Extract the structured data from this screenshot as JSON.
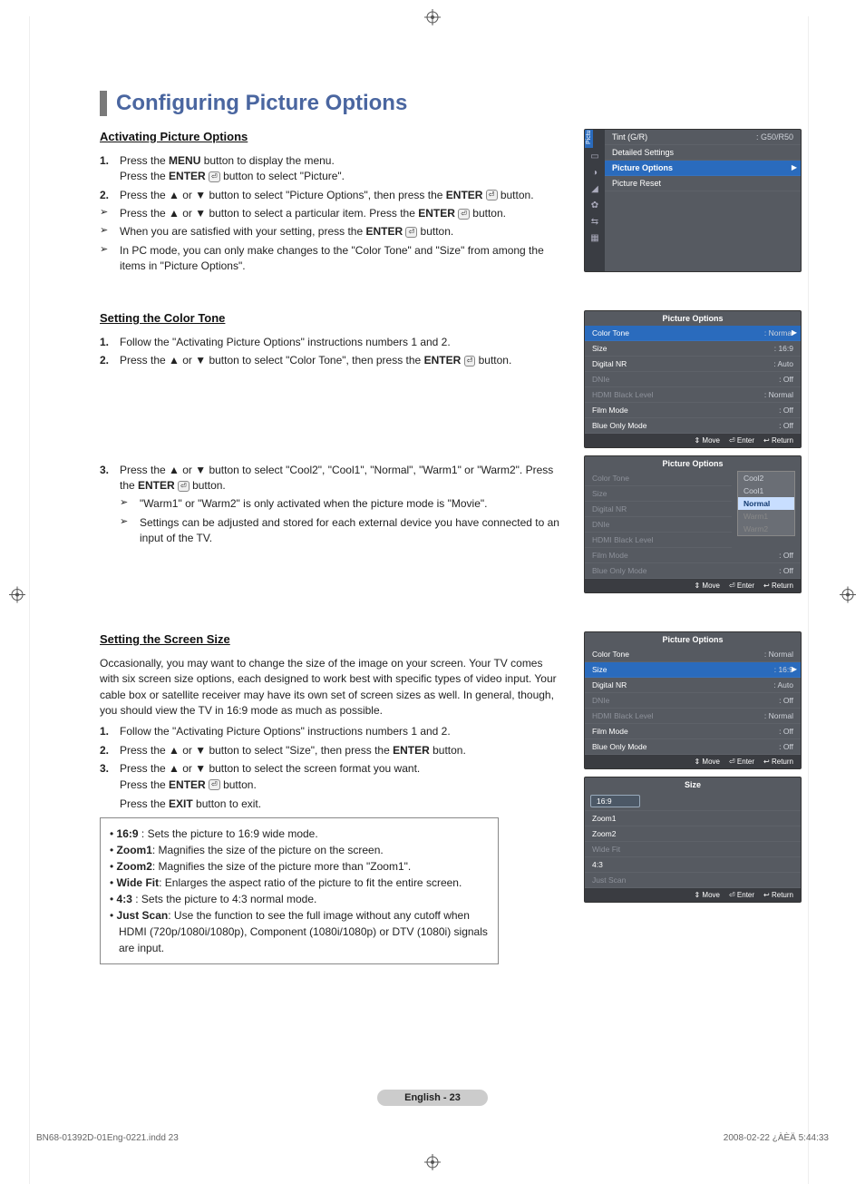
{
  "title": "Configuring Picture Options",
  "section1": {
    "heading": "Activating Picture Options",
    "step1a": "Press the ",
    "step1b": " button to display the menu.",
    "step1c": "Press the ",
    "step1d": " button to select \"Picture\".",
    "step2": "Press the ▲ or ▼ button to select \"Picture Options\", then press the ",
    "step2b": " button.",
    "note1": "Press the ▲ or ▼ button to select a particular item. Press the ",
    "note1b": " button.",
    "note2a": "When you are satisfied with your setting, press the ",
    "note2b": " button.",
    "note3": "In PC mode, you can only make changes to the \"Color Tone\" and \"Size\" from among the items in \"Picture Options\"."
  },
  "labels": {
    "menu": "MENU",
    "enter": "ENTER",
    "exit": "EXIT"
  },
  "section2": {
    "heading": "Setting the Color Tone",
    "step1": "Follow the \"Activating Picture Options\" instructions numbers 1 and 2.",
    "step2": "Press the ▲ or ▼ button to select \"Color Tone\", then press the ",
    "step2b": " button.",
    "step3": "Press the ▲ or ▼ button to select \"Cool2\", \"Cool1\", \"Normal\", \"Warm1\" or \"Warm2\". Press the ",
    "step3b": " button.",
    "note1": "\"Warm1\" or \"Warm2\" is only activated when the picture mode is \"Movie\".",
    "note2": "Settings can be adjusted and stored for each external device you have connected to an input of the TV."
  },
  "section3": {
    "heading": "Setting the Screen Size",
    "intro": "Occasionally, you may want to change the size of the image on your screen. Your TV comes with six screen size options, each designed to work best with specific types of video input. Your cable box or satellite receiver may have its own set of screen sizes as well. In general, though, you should view the TV in 16:9 mode as much as possible.",
    "step1": "Follow the \"Activating Picture Options\" instructions numbers 1 and 2.",
    "step2a": "Press the ▲ or ▼ button to select \"Size\", then press the ",
    "step2b": " button.",
    "step3a": "Press the ▲ or ▼ button to select the screen format you want.",
    "step3b": "Press the ",
    "step3c": " button.",
    "step3d": "Press the ",
    "step3e": " button to exit.",
    "bullets": {
      "b1a": "16:9",
      "b1b": " : Sets the picture to 16:9 wide mode.",
      "b2a": "Zoom1",
      "b2b": ": Magnifies the size of the picture on the screen.",
      "b3a": "Zoom2",
      "b3b": ": Magnifies the size of the picture more than \"Zoom1\".",
      "b4a": "Wide Fit",
      "b4b": ": Enlarges the aspect ratio of the picture to fit the entire screen.",
      "b5a": "4:3",
      "b5b": " : Sets the picture to 4:3 normal mode.",
      "b6a": "Just Scan",
      "b6b": ": Use the function to see the full image without any cutoff when HDMI (720p/1080i/1080p), Component (1080i/1080p) or DTV (1080i) signals are input."
    }
  },
  "osd_main": {
    "tint_label": "Tint (G/R)",
    "tint_val": ": G50/R50",
    "det": "Detailed Settings",
    "picopt": "Picture Options",
    "reset": "Picture Reset",
    "side_label": "Picture"
  },
  "osd_po": {
    "title": "Picture Options",
    "rows": {
      "color": "Color Tone",
      "color_v": ": Normal",
      "size": "Size",
      "size_v": ": 16:9",
      "dnr": "Digital NR",
      "dnr_v": ": Auto",
      "dnie": "DNIe",
      "dnie_v": ": Off",
      "hdmi": "HDMI Black Level",
      "hdmi_v": ": Normal",
      "film": "Film Mode",
      "film_v": ": Off",
      "blue": "Blue Only Mode",
      "blue_v": ": Off"
    }
  },
  "osd_drop": {
    "o1": "Cool2",
    "o2": "Cool1",
    "o3": "Normal",
    "o4": "Warm1",
    "o5": "Warm2"
  },
  "osd_size": {
    "title": "Size",
    "o1": "16:9",
    "o2": "Zoom1",
    "o3": "Zoom2",
    "o4": "Wide Fit",
    "o5": "4:3",
    "o6": "Just Scan"
  },
  "osd_foot": {
    "move": "Move",
    "enter": "Enter",
    "return": "Return"
  },
  "footer": {
    "page": "English - 23",
    "indd": "BN68-01392D-01Eng-0221.indd   23",
    "ts": "2008-02-22   ¿ÀÈÄ 5:44:33"
  }
}
